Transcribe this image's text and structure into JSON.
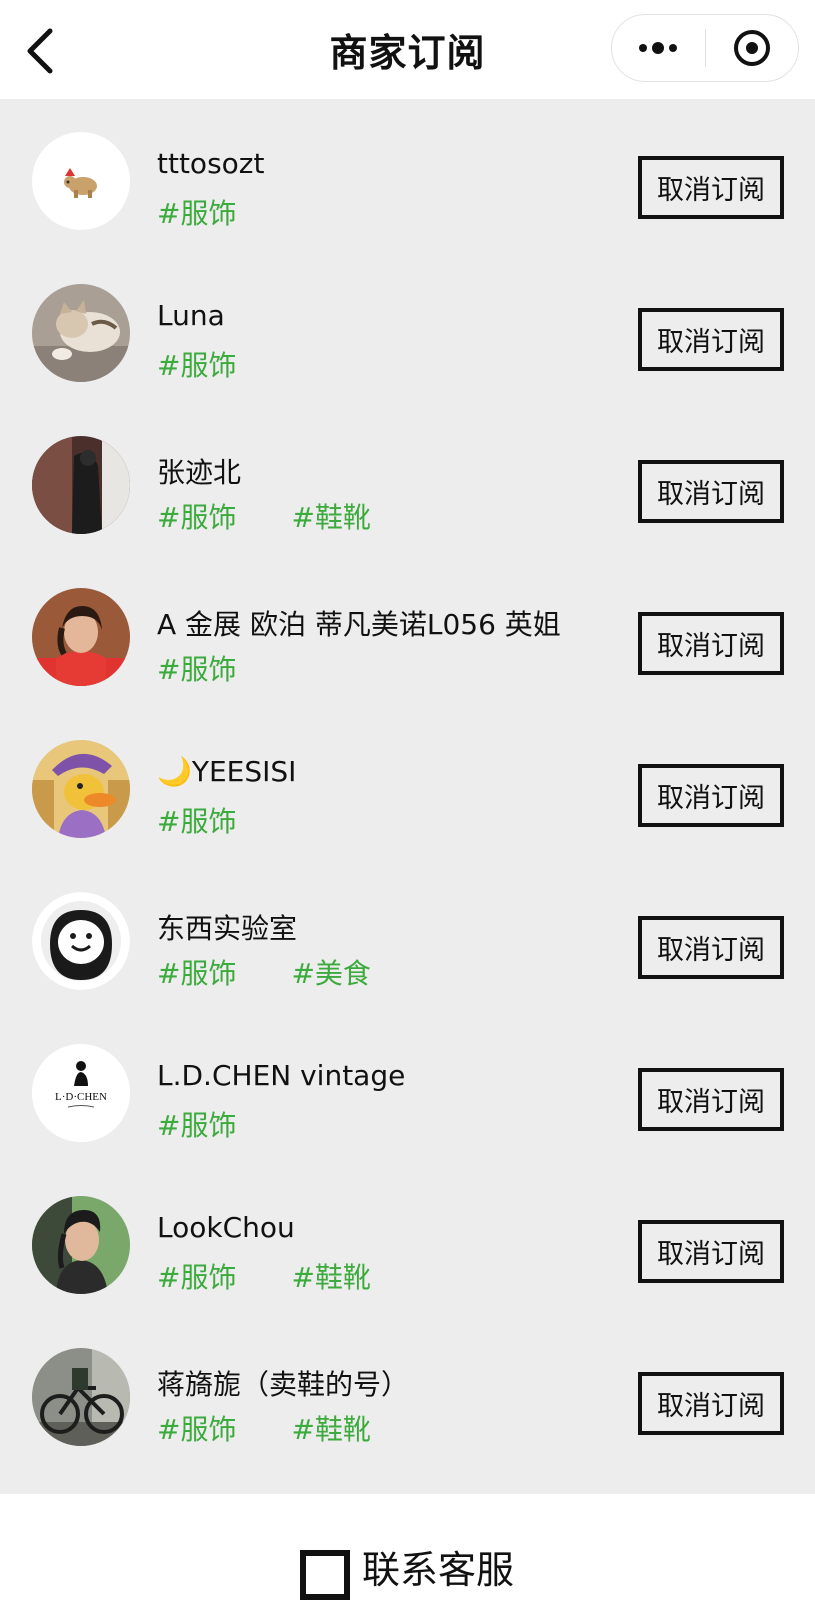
{
  "header": {
    "title": "商家订阅"
  },
  "subscriptions": [
    {
      "name": "tttosozt",
      "tags": [
        "#服饰"
      ],
      "button": "取消订阅",
      "avatar": "elephant-logo"
    },
    {
      "name": "Luna",
      "tags": [
        "#服饰"
      ],
      "button": "取消订阅",
      "avatar": "sleeping-cat-photo"
    },
    {
      "name": "张迹北",
      "tags": [
        "#服饰",
        "#鞋靴"
      ],
      "button": "取消订阅",
      "avatar": "mirror-selfie-photo"
    },
    {
      "name": "A 金展 欧泊 蒂凡美诺L056 英姐",
      "tags": [
        "#服饰"
      ],
      "button": "取消订阅",
      "avatar": "woman-red-shirt-photo"
    },
    {
      "name": "🌙YEESISI",
      "tags": [
        "#服饰"
      ],
      "button": "取消订阅",
      "avatar": "cartoon-duck"
    },
    {
      "name": "东西实验室",
      "tags": [
        "#服饰",
        "#美食"
      ],
      "button": "取消订阅",
      "avatar": "smiley-logo"
    },
    {
      "name": "L.D.CHEN vintage",
      "tags": [
        "#服饰"
      ],
      "button": "取消订阅",
      "avatar": "ldchen-logo",
      "avatar_text": "L·D·CHEN"
    },
    {
      "name": "LookChou",
      "tags": [
        "#服饰",
        "#鞋靴"
      ],
      "button": "取消订阅",
      "avatar": "man-portrait-photo"
    },
    {
      "name": "蒋旖旎（卖鞋的号）",
      "tags": [
        "#服饰",
        "#鞋靴"
      ],
      "button": "取消订阅",
      "avatar": "bicycle-photo"
    }
  ],
  "footer": {
    "contact_label": "联系客服"
  },
  "colors": {
    "tag": "#3daa3d",
    "list_background": "#ededed"
  }
}
